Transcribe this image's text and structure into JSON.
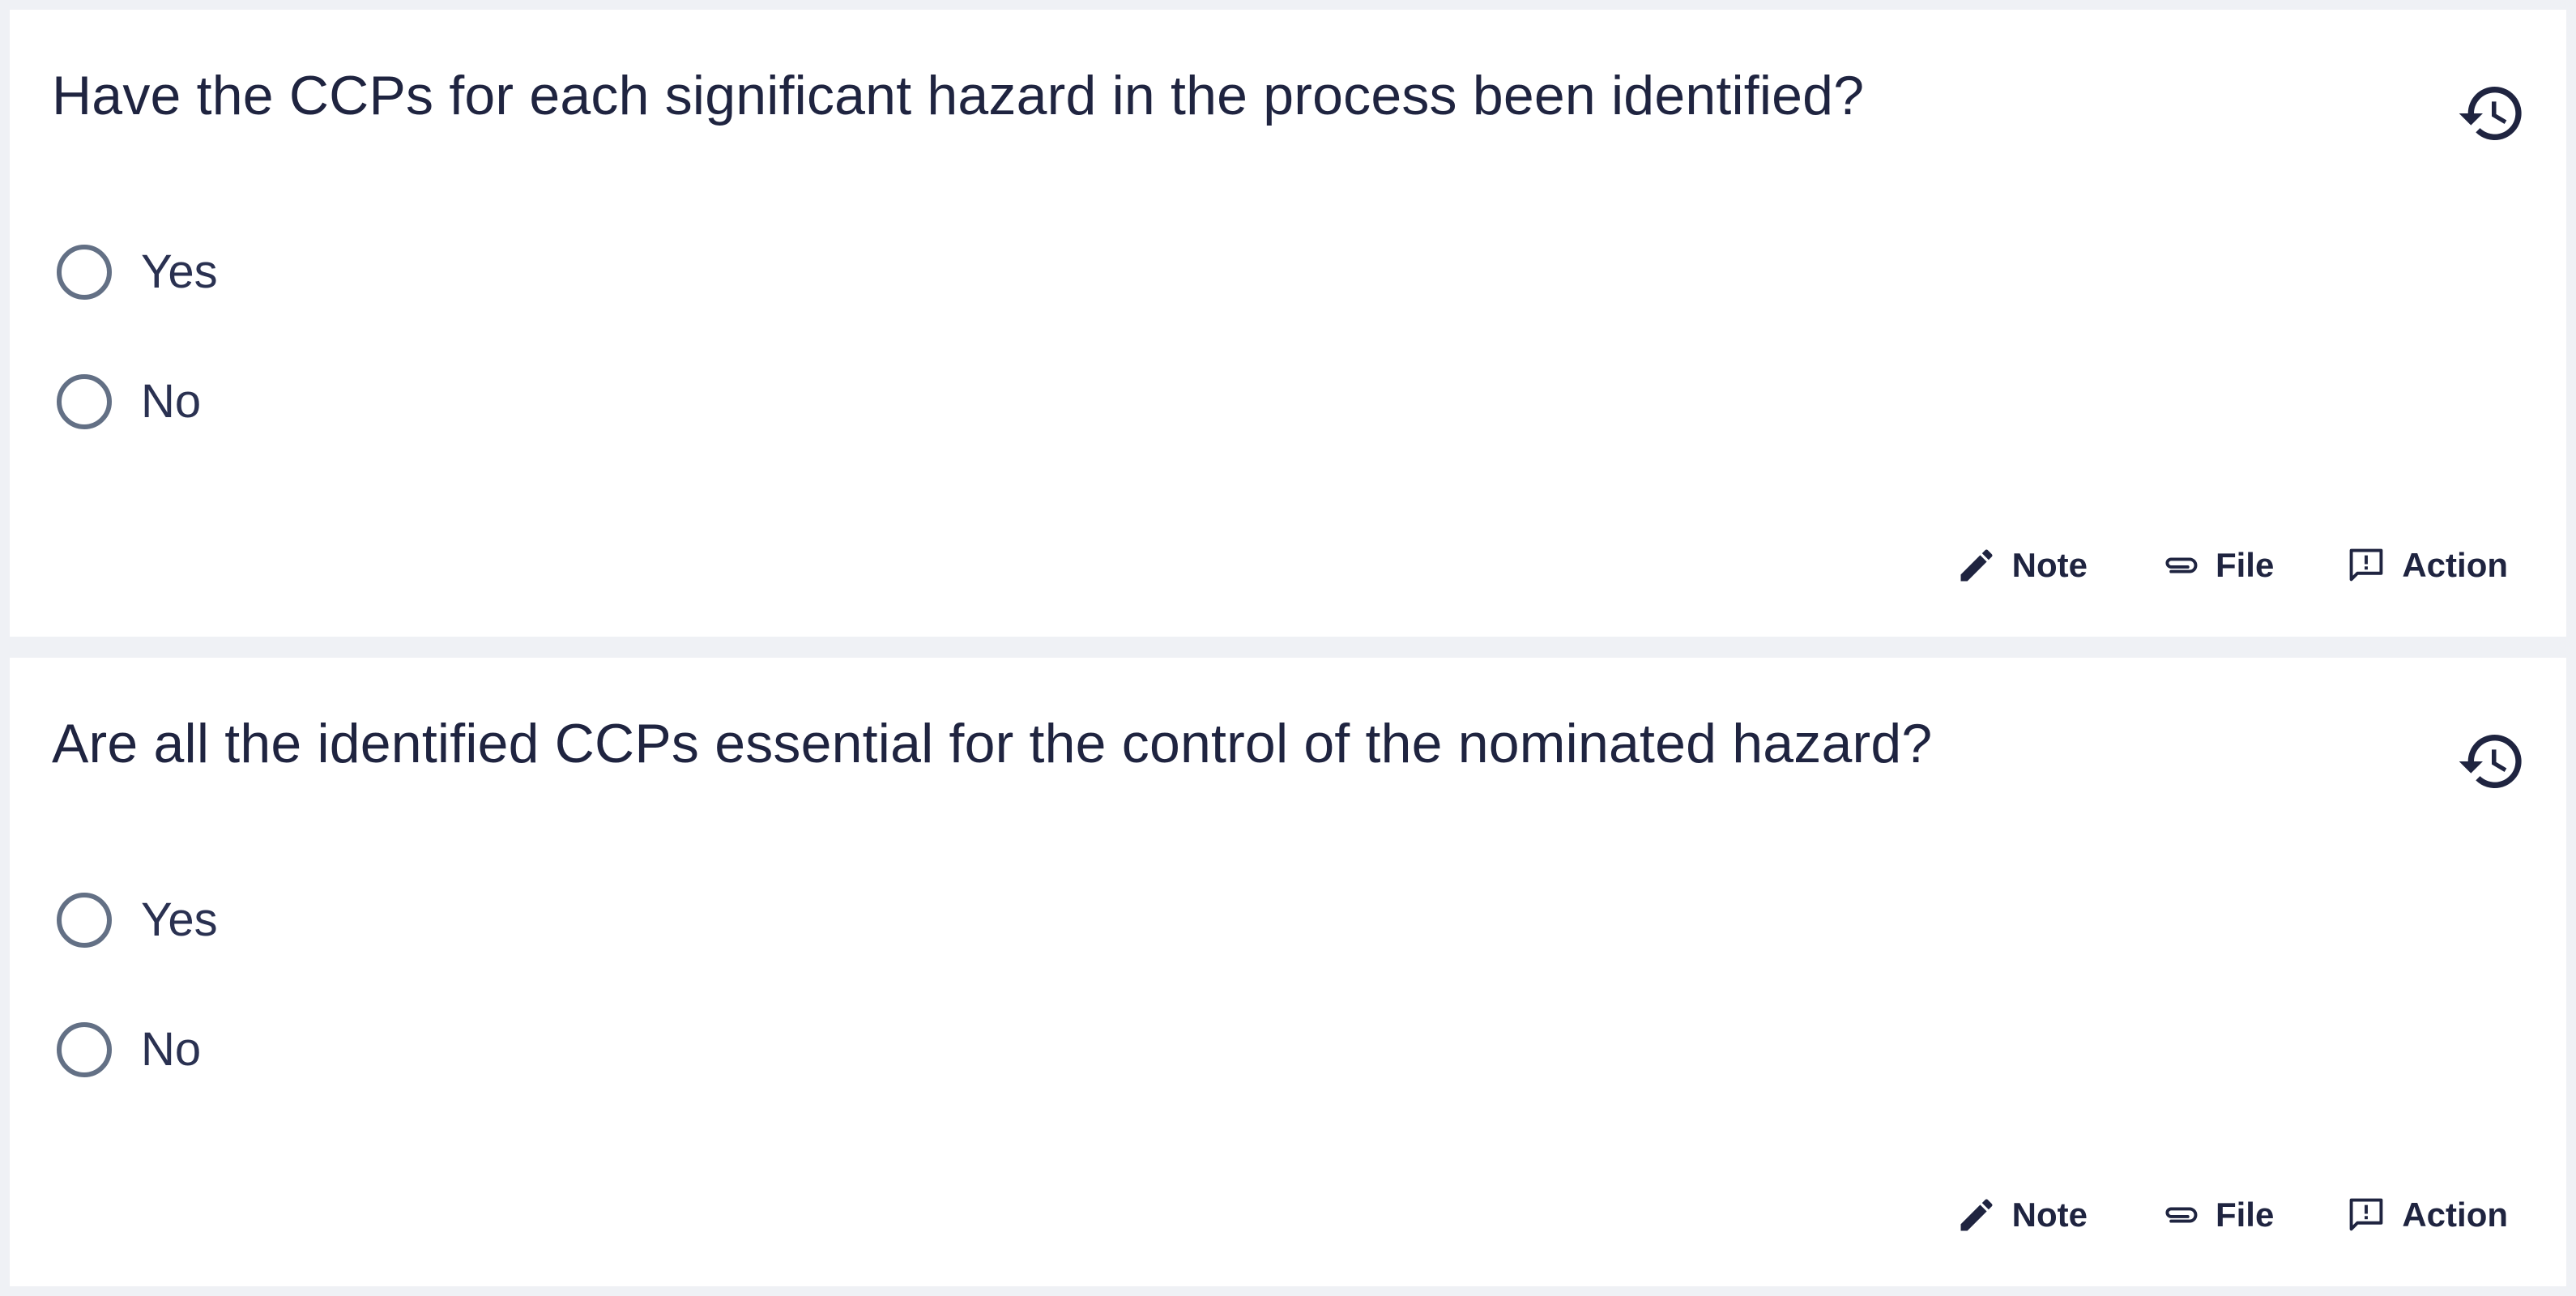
{
  "questions": [
    {
      "title": "Have the CCPs for each significant hazard in the process been identified?",
      "history_icon": "history-icon",
      "options": [
        {
          "label": "Yes",
          "selected": false
        },
        {
          "label": "No",
          "selected": false
        }
      ],
      "actions": {
        "note": {
          "label": "Note",
          "icon": "pencil-icon"
        },
        "file": {
          "label": "File",
          "icon": "paperclip-icon"
        },
        "action": {
          "label": "Action",
          "icon": "feedback-icon"
        }
      }
    },
    {
      "title": "Are all the identified CCPs essential for the control of the nominated hazard?",
      "history_icon": "history-icon",
      "options": [
        {
          "label": "Yes",
          "selected": false
        },
        {
          "label": "No",
          "selected": false
        }
      ],
      "actions": {
        "note": {
          "label": "Note",
          "icon": "pencil-icon"
        },
        "file": {
          "label": "File",
          "icon": "paperclip-icon"
        },
        "action": {
          "label": "Action",
          "icon": "feedback-icon"
        }
      }
    }
  ],
  "colors": {
    "background": "#eff1f5",
    "card": "#ffffff",
    "text": "#1f2440",
    "radio_border": "#637085"
  }
}
